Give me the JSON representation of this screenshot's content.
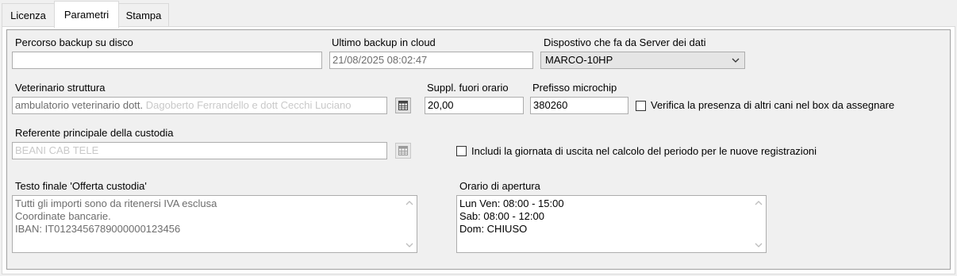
{
  "tabs": [
    {
      "label": "Licenza",
      "active": false
    },
    {
      "label": "Parametri",
      "active": true
    },
    {
      "label": "Stampa",
      "active": false
    }
  ],
  "backup_path": {
    "label": "Percorso backup su disco",
    "value": ""
  },
  "last_cloud_backup": {
    "label": "Ultimo backup in cloud",
    "value": "21/08/2025 08:02:47"
  },
  "data_server": {
    "label": "Dispostivo che fa da Server dei dati",
    "value": "MARCO-10HP"
  },
  "vet": {
    "label": "Veterinario struttura",
    "value_main": "ambulatorio veterinario dott.",
    "value_faded": "Dagoberto Ferrandello e dott Cecchi Luciano"
  },
  "surcharge": {
    "label": "Suppl. fuori orario",
    "value": "20,00"
  },
  "microchip": {
    "label": "Prefisso microchip",
    "value": "380260"
  },
  "check_other_dogs": {
    "label": "Verifica la presenza di altri cani nel box da assegnare",
    "checked": false
  },
  "custody_ref": {
    "label": "Referente principale della custodia",
    "value": "BEANI CAB TELE"
  },
  "include_exit_day": {
    "label": "Includi la giornata di uscita nel calcolo del periodo per le nuove registrazioni",
    "checked": false
  },
  "offer_text": {
    "label": "Testo finale 'Offerta custodia'",
    "lines": [
      "Tutti gli importi sono da ritenersi IVA esclusa",
      "Coordinate bancarie.",
      "IBAN: IT0123456789000000123456"
    ]
  },
  "opening_hours": {
    "label": "Orario di apertura",
    "lines": [
      "Lun Ven: 08:00 - 15:00",
      "Sab: 08:00 - 12:00",
      "Dom: CHIUSO"
    ]
  },
  "icons": {
    "lookup": "grid-lookup-icon",
    "dropdown": "chevron-down-icon"
  }
}
